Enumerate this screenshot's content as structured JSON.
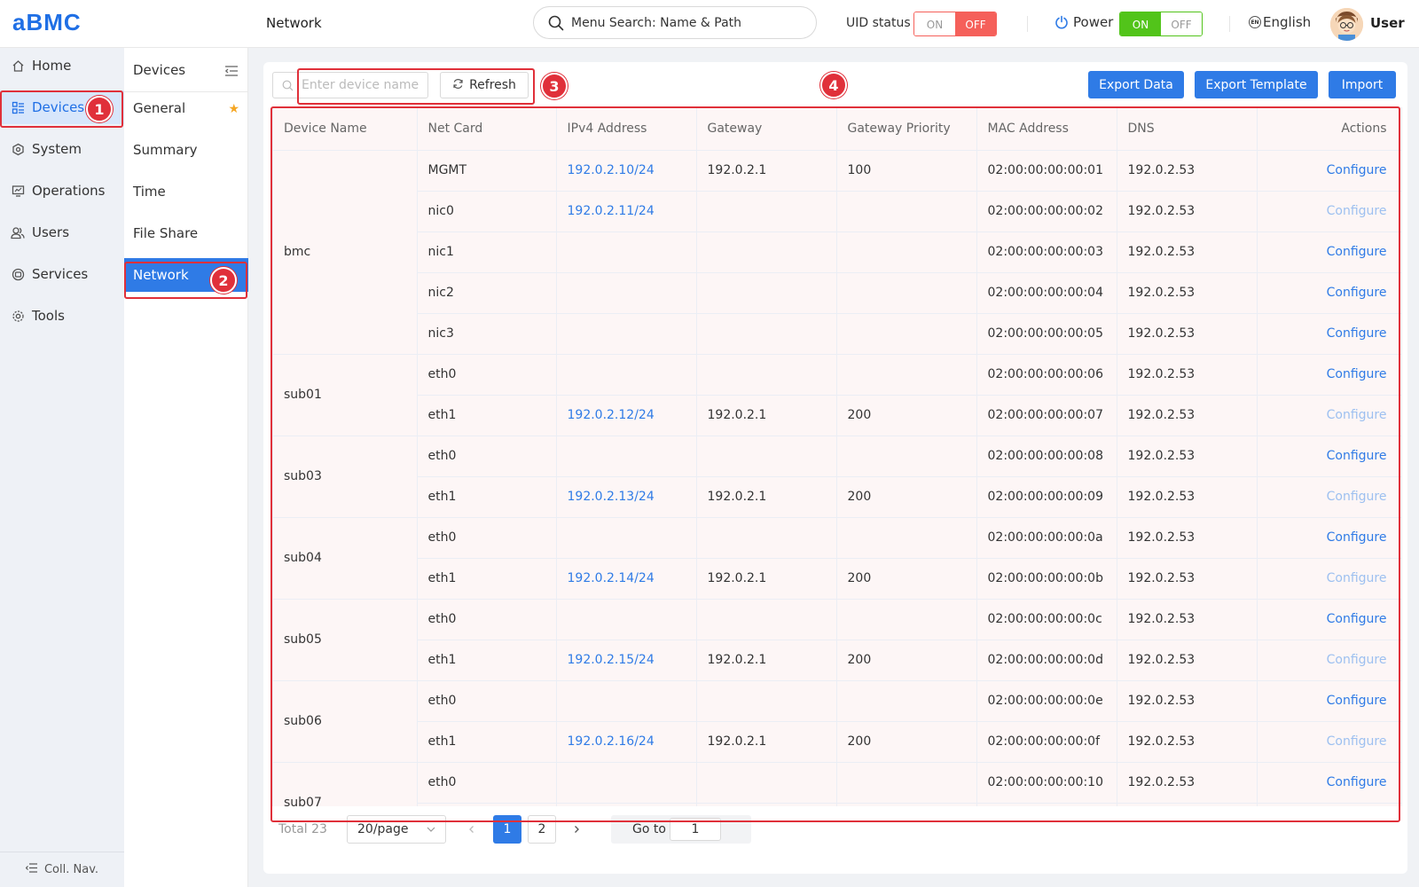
{
  "header": {
    "logo": "aBMC",
    "page_title": "Network",
    "search_placeholder": "Menu Search: Name & Path",
    "uid_label": "UID status",
    "uid_on": "ON",
    "uid_off": "OFF",
    "power_label": "Power",
    "power_on": "ON",
    "power_off": "OFF",
    "language": "English",
    "language_badge": "EN",
    "user": "User"
  },
  "sidebar": {
    "items": [
      {
        "label": "Home",
        "icon": "home-icon"
      },
      {
        "label": "Devices",
        "icon": "devices-icon",
        "active": true
      },
      {
        "label": "System",
        "icon": "system-icon"
      },
      {
        "label": "Operations",
        "icon": "operations-icon"
      },
      {
        "label": "Users",
        "icon": "users-icon"
      },
      {
        "label": "Services",
        "icon": "services-icon"
      },
      {
        "label": "Tools",
        "icon": "tools-icon"
      }
    ],
    "collapse_label": "Coll. Nav."
  },
  "subbar": {
    "title": "Devices",
    "items": [
      {
        "label": "General",
        "starred": true
      },
      {
        "label": "Summary"
      },
      {
        "label": "Time"
      },
      {
        "label": "File Share"
      },
      {
        "label": "Network",
        "active": true
      }
    ]
  },
  "toolbar": {
    "device_placeholder": "Enter device name",
    "refresh_label": "Refresh",
    "export_data_label": "Export Data",
    "export_template_label": "Export Template",
    "import_label": "Import"
  },
  "annotations": [
    "1",
    "2",
    "3",
    "4"
  ],
  "table": {
    "columns": [
      "Device Name",
      "Net Card",
      "IPv4 Address",
      "Gateway",
      "Gateway Priority",
      "MAC Address",
      "DNS",
      "Actions"
    ],
    "action_label": "Configure",
    "groups": [
      {
        "device": "bmc",
        "rows": [
          {
            "card": "MGMT",
            "ip": "192.0.2.10/24",
            "gw": "192.0.2.1",
            "prio": "100",
            "mac": "02:00:00:00:00:01",
            "dns": "192.0.2.53",
            "enabled": true
          },
          {
            "card": "nic0",
            "ip": "192.0.2.11/24",
            "gw": "",
            "prio": "",
            "mac": "02:00:00:00:00:02",
            "dns": "192.0.2.53",
            "enabled": false
          },
          {
            "card": "nic1",
            "ip": "",
            "gw": "",
            "prio": "",
            "mac": "02:00:00:00:00:03",
            "dns": "192.0.2.53",
            "enabled": true
          },
          {
            "card": "nic2",
            "ip": "",
            "gw": "",
            "prio": "",
            "mac": "02:00:00:00:00:04",
            "dns": "192.0.2.53",
            "enabled": true
          },
          {
            "card": "nic3",
            "ip": "",
            "gw": "",
            "prio": "",
            "mac": "02:00:00:00:00:05",
            "dns": "192.0.2.53",
            "enabled": true
          }
        ]
      },
      {
        "device": "sub01",
        "rows": [
          {
            "card": "eth0",
            "ip": "",
            "gw": "",
            "prio": "",
            "mac": "02:00:00:00:00:06",
            "dns": "192.0.2.53",
            "enabled": true
          },
          {
            "card": "eth1",
            "ip": "192.0.2.12/24",
            "gw": "192.0.2.1",
            "prio": "200",
            "mac": "02:00:00:00:00:07",
            "dns": "192.0.2.53",
            "enabled": false
          }
        ]
      },
      {
        "device": "sub03",
        "rows": [
          {
            "card": "eth0",
            "ip": "",
            "gw": "",
            "prio": "",
            "mac": "02:00:00:00:00:08",
            "dns": "192.0.2.53",
            "enabled": true
          },
          {
            "card": "eth1",
            "ip": "192.0.2.13/24",
            "gw": "192.0.2.1",
            "prio": "200",
            "mac": "02:00:00:00:00:09",
            "dns": "192.0.2.53",
            "enabled": false
          }
        ]
      },
      {
        "device": "sub04",
        "rows": [
          {
            "card": "eth0",
            "ip": "",
            "gw": "",
            "prio": "",
            "mac": "02:00:00:00:00:0a",
            "dns": "192.0.2.53",
            "enabled": true
          },
          {
            "card": "eth1",
            "ip": "192.0.2.14/24",
            "gw": "192.0.2.1",
            "prio": "200",
            "mac": "02:00:00:00:00:0b",
            "dns": "192.0.2.53",
            "enabled": false
          }
        ]
      },
      {
        "device": "sub05",
        "rows": [
          {
            "card": "eth0",
            "ip": "",
            "gw": "",
            "prio": "",
            "mac": "02:00:00:00:00:0c",
            "dns": "192.0.2.53",
            "enabled": true
          },
          {
            "card": "eth1",
            "ip": "192.0.2.15/24",
            "gw": "192.0.2.1",
            "prio": "200",
            "mac": "02:00:00:00:00:0d",
            "dns": "192.0.2.53",
            "enabled": false
          }
        ]
      },
      {
        "device": "sub06",
        "rows": [
          {
            "card": "eth0",
            "ip": "",
            "gw": "",
            "prio": "",
            "mac": "02:00:00:00:00:0e",
            "dns": "192.0.2.53",
            "enabled": true
          },
          {
            "card": "eth1",
            "ip": "192.0.2.16/24",
            "gw": "192.0.2.1",
            "prio": "200",
            "mac": "02:00:00:00:00:0f",
            "dns": "192.0.2.53",
            "enabled": false
          }
        ]
      },
      {
        "device": "sub07",
        "rows": [
          {
            "card": "eth0",
            "ip": "",
            "gw": "",
            "prio": "",
            "mac": "02:00:00:00:00:10",
            "dns": "192.0.2.53",
            "enabled": true
          },
          {
            "card": "",
            "ip": "",
            "gw": "",
            "prio": "",
            "mac": "",
            "dns": "",
            "enabled": false
          }
        ]
      }
    ]
  },
  "pagination": {
    "total": "Total 23",
    "page_size": "20/page",
    "pages": [
      "1",
      "2"
    ],
    "current": "1",
    "goto_label": "Go to",
    "goto_value": "1"
  }
}
